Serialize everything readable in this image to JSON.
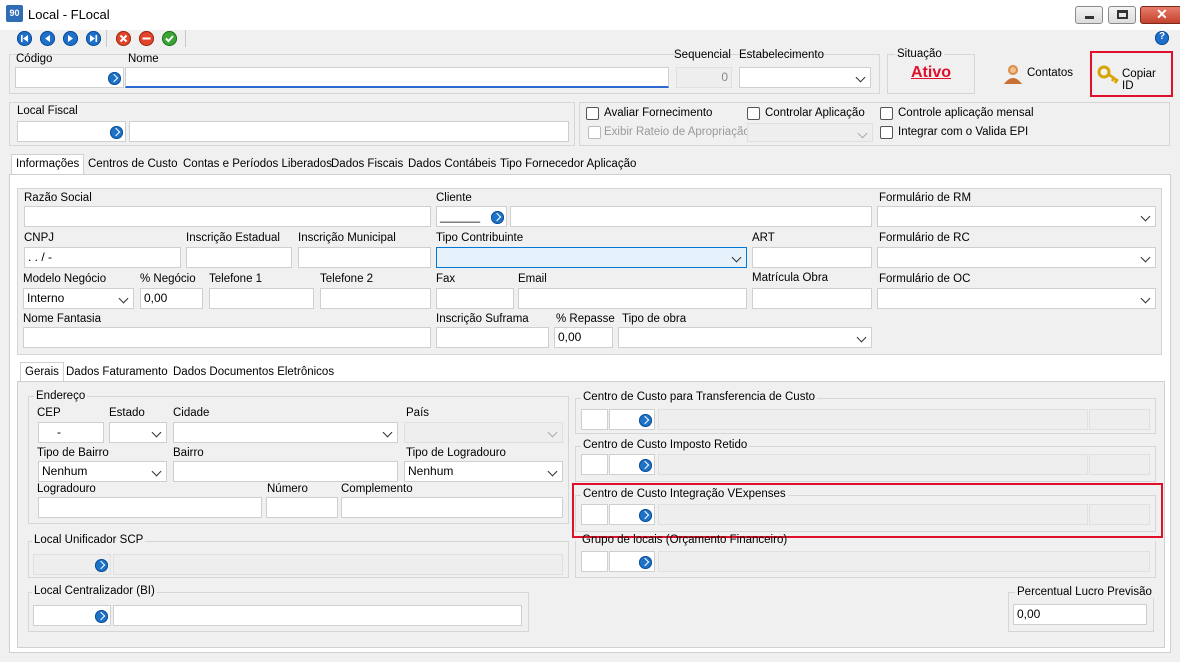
{
  "window": {
    "title": "Local - FLocal",
    "icon": "90"
  },
  "toolbar": {
    "icons": [
      "first-icon",
      "prev-icon",
      "next-icon",
      "last-icon",
      "cancel-icon",
      "delete-icon",
      "confirm-icon",
      "help-icon"
    ]
  },
  "header": {
    "codigo_label": "Código",
    "nome_label": "Nome",
    "sequencial_label": "Sequencial",
    "sequencial_value": "0",
    "estabelecimento_label": "Estabelecimento",
    "situacao_label": "Situação",
    "situacao_value": "Ativo",
    "contatos_label": "Contatos",
    "copiar_id_label": "Copiar ID"
  },
  "local_fiscal": {
    "label": "Local Fiscal",
    "avaliar": "Avaliar Fornecimento",
    "controlar": "Controlar Aplicação",
    "controle_mensal": "Controle aplicação mensal",
    "exibir_rateio": "Exibir Rateio de Apropriação",
    "integrar_epi": "Integrar com o Valida EPI"
  },
  "tabs": [
    "Informações",
    "Centros de Custo",
    "Contas e Períodos Liberados",
    "Dados Fiscais",
    "Dados Contábeis",
    "Tipo Fornecedor Aplicação"
  ],
  "info": {
    "razao_social": "Razão Social",
    "cliente": "Cliente",
    "cliente_value": "______",
    "formulario_rm": "Formulário de RM",
    "cnpj": "CNPJ",
    "cnpj_value": " .   .    /    -",
    "inscricao_estadual": "Inscrição Estadual",
    "inscricao_municipal": "Inscrição Municipal",
    "tipo_contribuinte": "Tipo Contribuinte",
    "art": "ART",
    "formulario_rc": "Formulário de RC",
    "modelo_negocio": "Modelo Negócio",
    "modelo_negocio_value": "Interno",
    "perc_negocio": "% Negócio",
    "perc_negocio_value": "0,00",
    "telefone1": "Telefone 1",
    "telefone2": "Telefone 2",
    "fax": "Fax",
    "email": "Email",
    "matricula_obra": "Matrícula Obra",
    "formulario_oc": "Formulário de OC",
    "nome_fantasia": "Nome Fantasia",
    "inscricao_suframa": "Inscrição Suframa",
    "perc_repasse": "% Repasse",
    "perc_repasse_value": "0,00",
    "tipo_obra": "Tipo de obra"
  },
  "subtabs": [
    "Gerais",
    "Dados Faturamento",
    "Dados Documentos Eletrônicos"
  ],
  "endereco": {
    "title": "Endereço",
    "cep": "CEP",
    "cep_value": "-",
    "estado": "Estado",
    "cidade": "Cidade",
    "pais": "País",
    "tipo_bairro": "Tipo de Bairro",
    "tipo_bairro_value": "Nenhum",
    "bairro": "Bairro",
    "tipo_logradouro": "Tipo de Logradouro",
    "tipo_logradouro_value": "Nenhum",
    "logradouro": "Logradouro",
    "numero": "Número",
    "complemento": "Complemento"
  },
  "local_unificador": "Local Unificador SCP",
  "local_centralizador": "Local Centralizador (BI)",
  "percentual_lucro": {
    "label": "Percentual Lucro Previsão",
    "value": "0,00"
  },
  "centros": {
    "transferencia": "Centro de Custo para Transferencia de Custo",
    "imposto": "Centro de Custo Imposto Retido",
    "vexpenses": "Centro de Custo Integração VExpenses",
    "grupo": "Grupo de locais (Orçamento Financeiro)"
  },
  "colors": {
    "accent": "#1e73c8",
    "highlight": "#e0102a",
    "status": "#e0102a"
  }
}
